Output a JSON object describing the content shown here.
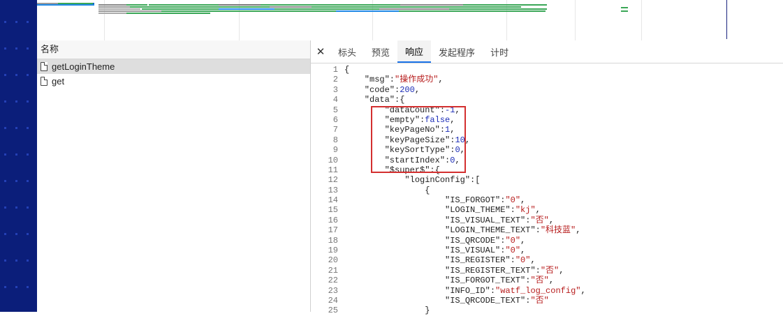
{
  "list": {
    "header": "名称",
    "rows": [
      {
        "name": "getLoginTheme",
        "selected": true
      },
      {
        "name": "get",
        "selected": false
      }
    ]
  },
  "tabs": [
    "标头",
    "预览",
    "响应",
    "发起程序",
    "计时"
  ],
  "active_tab": "响应",
  "code_lines": [
    {
      "n": "1",
      "parts": [
        [
          "p",
          "{"
        ]
      ]
    },
    {
      "n": "2",
      "parts": [
        [
          "p",
          "    \"msg\":"
        ],
        [
          "s",
          "\"操作成功\""
        ],
        [
          "p",
          ","
        ]
      ]
    },
    {
      "n": "3",
      "parts": [
        [
          "p",
          "    \"code\":"
        ],
        [
          "n",
          "200"
        ],
        [
          "p",
          ","
        ]
      ]
    },
    {
      "n": "4",
      "parts": [
        [
          "p",
          "    \"data\":{"
        ]
      ]
    },
    {
      "n": "5",
      "parts": [
        [
          "p",
          "        \"dataCount\":"
        ],
        [
          "n",
          "-1"
        ],
        [
          "p",
          ","
        ]
      ]
    },
    {
      "n": "6",
      "parts": [
        [
          "p",
          "        \"empty\":"
        ],
        [
          "n",
          "false"
        ],
        [
          "p",
          ","
        ]
      ]
    },
    {
      "n": "7",
      "parts": [
        [
          "p",
          "        \"keyPageNo\":"
        ],
        [
          "n",
          "1"
        ],
        [
          "p",
          ","
        ]
      ]
    },
    {
      "n": "8",
      "parts": [
        [
          "p",
          "        \"keyPageSize\":"
        ],
        [
          "n",
          "10"
        ],
        [
          "p",
          ","
        ]
      ]
    },
    {
      "n": "9",
      "parts": [
        [
          "p",
          "        \"keySortType\":"
        ],
        [
          "n",
          "0"
        ],
        [
          "p",
          ","
        ]
      ]
    },
    {
      "n": "10",
      "parts": [
        [
          "p",
          "        \"startIndex\":"
        ],
        [
          "n",
          "0"
        ],
        [
          "p",
          ","
        ]
      ]
    },
    {
      "n": "11",
      "parts": [
        [
          "p",
          "        \"$super$\":{"
        ]
      ]
    },
    {
      "n": "12",
      "parts": [
        [
          "p",
          "            \"loginConfig\":["
        ]
      ]
    },
    {
      "n": "13",
      "parts": [
        [
          "p",
          "                {"
        ]
      ]
    },
    {
      "n": "14",
      "parts": [
        [
          "p",
          "                    \"IS_FORGOT\":"
        ],
        [
          "s",
          "\"0\""
        ],
        [
          "p",
          ","
        ]
      ]
    },
    {
      "n": "15",
      "parts": [
        [
          "p",
          "                    \"LOGIN_THEME\":"
        ],
        [
          "s",
          "\"kj\""
        ],
        [
          "p",
          ","
        ]
      ]
    },
    {
      "n": "16",
      "parts": [
        [
          "p",
          "                    \"IS_VISUAL_TEXT\":"
        ],
        [
          "s",
          "\"否\""
        ],
        [
          "p",
          ","
        ]
      ]
    },
    {
      "n": "17",
      "parts": [
        [
          "p",
          "                    \"LOGIN_THEME_TEXT\":"
        ],
        [
          "s",
          "\"科技蓝\""
        ],
        [
          "p",
          ","
        ]
      ]
    },
    {
      "n": "18",
      "parts": [
        [
          "p",
          "                    \"IS_QRCODE\":"
        ],
        [
          "s",
          "\"0\""
        ],
        [
          "p",
          ","
        ]
      ]
    },
    {
      "n": "19",
      "parts": [
        [
          "p",
          "                    \"IS_VISUAL\":"
        ],
        [
          "s",
          "\"0\""
        ],
        [
          "p",
          ","
        ]
      ]
    },
    {
      "n": "20",
      "parts": [
        [
          "p",
          "                    \"IS_REGISTER\":"
        ],
        [
          "s",
          "\"0\""
        ],
        [
          "p",
          ","
        ]
      ]
    },
    {
      "n": "21",
      "parts": [
        [
          "p",
          "                    \"IS_REGISTER_TEXT\":"
        ],
        [
          "s",
          "\"否\""
        ],
        [
          "p",
          ","
        ]
      ]
    },
    {
      "n": "22",
      "parts": [
        [
          "p",
          "                    \"IS_FORGOT_TEXT\":"
        ],
        [
          "s",
          "\"否\""
        ],
        [
          "p",
          ","
        ]
      ]
    },
    {
      "n": "23",
      "parts": [
        [
          "p",
          "                    \"INFO_ID\":"
        ],
        [
          "s",
          "\"watf_log_config\""
        ],
        [
          "p",
          ","
        ]
      ]
    },
    {
      "n": "24",
      "parts": [
        [
          "p",
          "                    \"IS_QRCODE_TEXT\":"
        ],
        [
          "s",
          "\"否\""
        ]
      ]
    },
    {
      "n": "25",
      "parts": [
        [
          "p",
          "                }"
        ]
      ]
    }
  ],
  "colors": {
    "highlight_box": "#d32f2f",
    "string": "#b71c1c",
    "number": "#1c2db7",
    "active_tab_underline": "#1a73e8"
  }
}
